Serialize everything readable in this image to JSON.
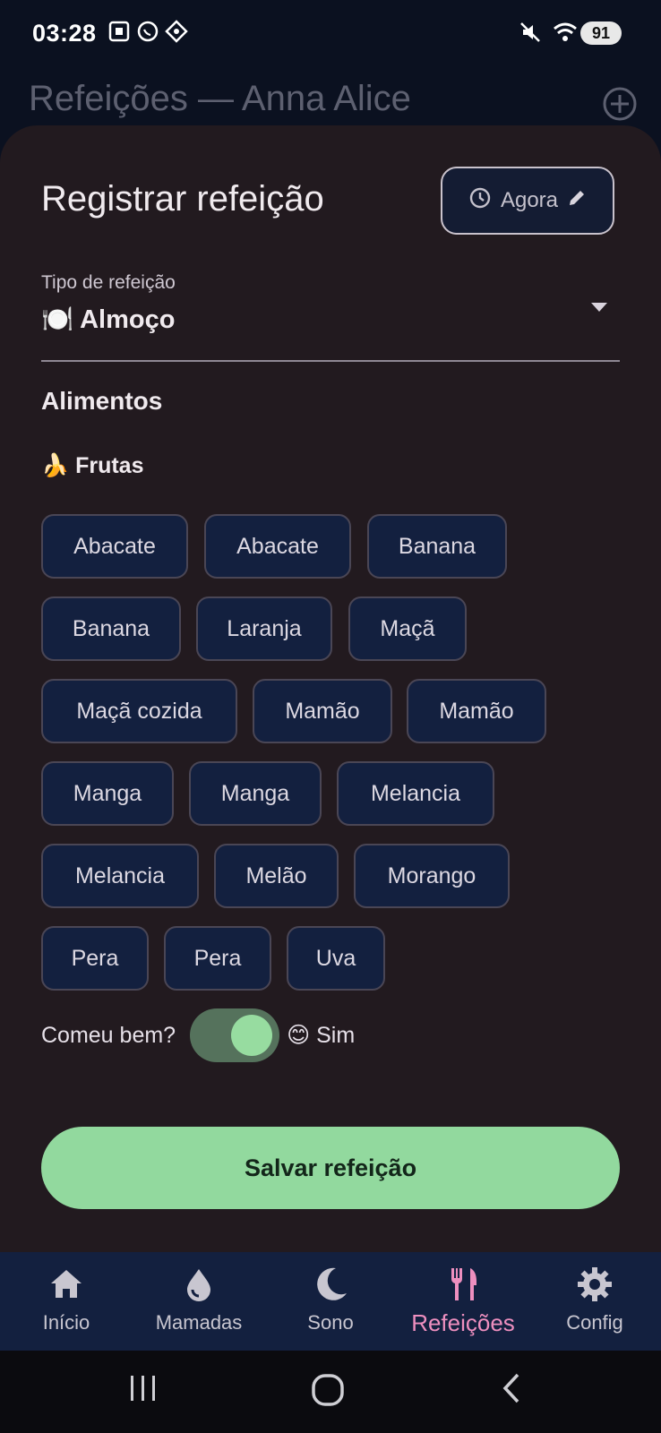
{
  "status_bar": {
    "time": "03:28",
    "battery": "91"
  },
  "app_bar": {
    "title": "Refeições — Anna Alice"
  },
  "sheet": {
    "title": "Registrar refeição",
    "time_button_label": "Agora",
    "meal_type_label": "Tipo de refeição",
    "meal_type_value": "🍽️ Almoço",
    "foods_heading": "Alimentos",
    "category_heading": "🍌 Frutas",
    "chips": [
      "Abacate",
      "Abacate",
      "Banana",
      "Banana",
      "Laranja",
      "Maçã",
      "Maçã cozida",
      "Mamão",
      "Mamão",
      "Manga",
      "Manga",
      "Melancia",
      "Melancia",
      "Melão",
      "Morango",
      "Pera",
      "Pera",
      "Uva"
    ],
    "ate_well_label": "Comeu bem?",
    "ate_well_value": "😊 Sim",
    "save_label": "Salvar refeição"
  },
  "bottom_nav": {
    "items": [
      {
        "label": "Início",
        "icon": "home-icon"
      },
      {
        "label": "Mamadas",
        "icon": "drop-icon"
      },
      {
        "label": "Sono",
        "icon": "moon-icon"
      },
      {
        "label": "Refeições",
        "icon": "utensils-icon"
      },
      {
        "label": "Config",
        "icon": "gear-icon"
      }
    ],
    "active_index": 3
  },
  "colors": {
    "accent": "#92d99e",
    "active_nav": "#ee8fbf",
    "sheet_bg": "#221a1f",
    "chip_bg": "#13203f"
  }
}
